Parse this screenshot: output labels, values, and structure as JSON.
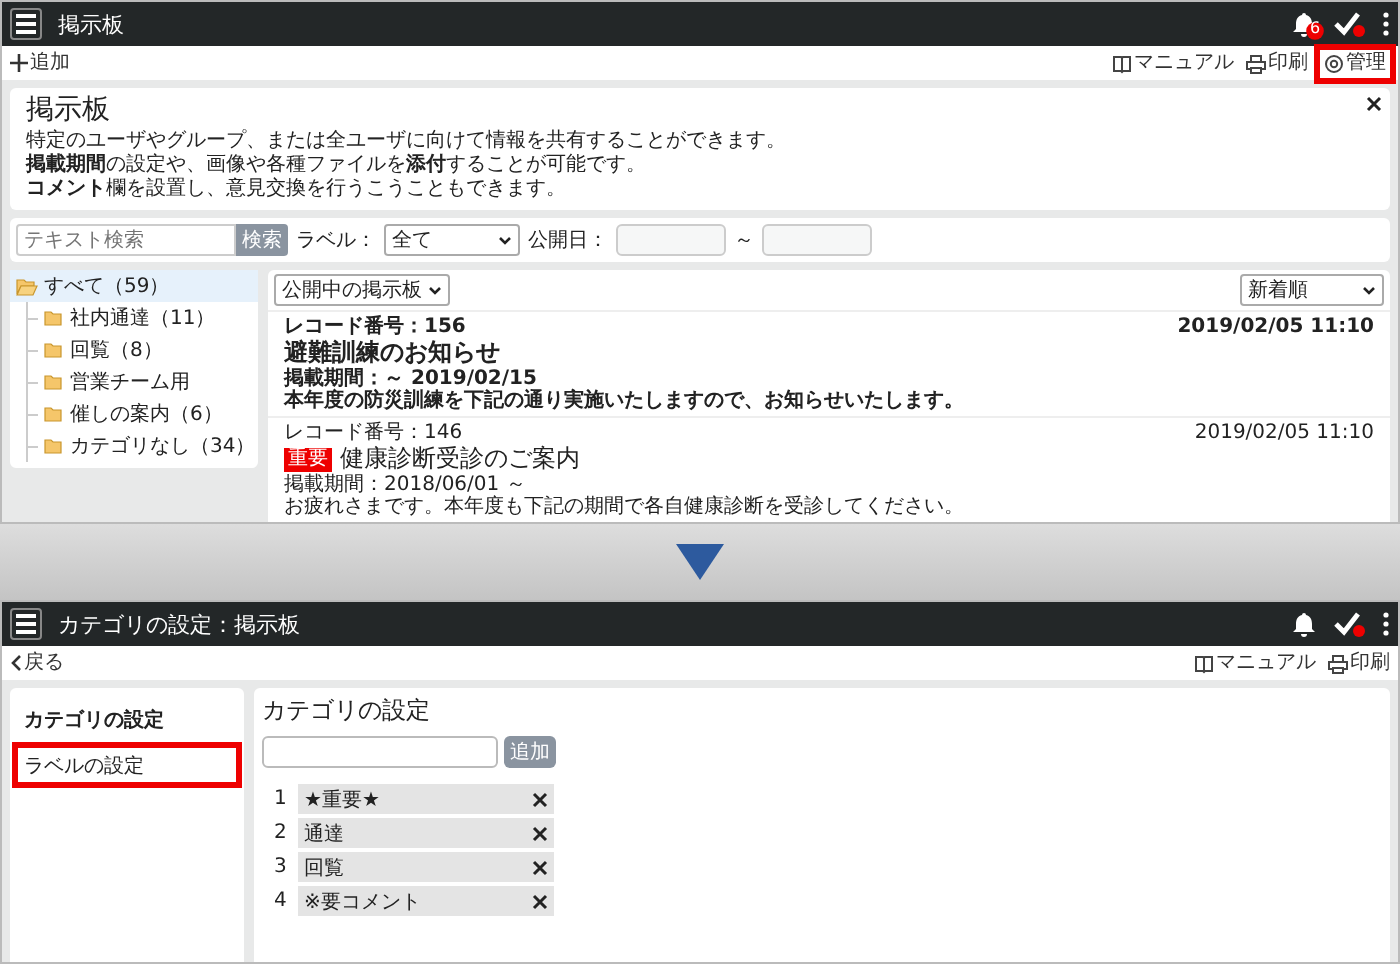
{
  "top_screen": {
    "header": {
      "title": "掲示板",
      "notification_count": "6"
    },
    "toolbar": {
      "add": "追加",
      "links": [
        {
          "kind": "manual",
          "label": "マニュアル",
          "highlighted": false
        },
        {
          "kind": "print",
          "label": "印刷",
          "highlighted": false
        },
        {
          "kind": "admin",
          "label": "管理",
          "highlighted": true
        }
      ]
    },
    "info_panel": {
      "title": "掲示板",
      "lines": [
        "特定のユーザやグループ、または全ユーザに向けて情報を共有することができます。",
        "**掲載期間**の設定や、画像や各種ファイルを**添付**することが可能です。",
        "**コメント**欄を設置し、意見交換を行うこうこともできます。"
      ]
    },
    "filter": {
      "search_placeholder": "テキスト検索",
      "search_button": "検索",
      "label_label": "ラベル：",
      "label_value": "全て",
      "date_label": "公開日：",
      "date_separator": "～"
    },
    "tree": [
      {
        "label": "すべて（59）",
        "selected": true,
        "expanded": true,
        "children": [
          {
            "label": "社内通達（11）",
            "selected": false
          },
          {
            "label": "回覧（8）",
            "selected": false
          },
          {
            "label": "営業チーム用",
            "selected": false
          },
          {
            "label": "催しの案内（6）",
            "selected": false
          },
          {
            "label": "カテゴリなし（34）",
            "selected": false
          }
        ]
      }
    ],
    "list": {
      "status_filter": "公開中の掲示板",
      "sort": "新着順",
      "posts": [
        {
          "record": "レコード番号：156",
          "title": "避難訓練のお知らせ",
          "period": "掲載期間：～ 2019/02/15",
          "body": "本年度の防災訓練を下記の通り実施いたしますので、お知らせいたします。",
          "date": "2019/02/05 11:10",
          "unread": true
        },
        {
          "record": "レコード番号：146",
          "tag": "重要",
          "title": "健康診断受診のご案内",
          "period": "掲載期間：2018/06/01 ～",
          "body": "お疲れさまです。本年度も下記の期間で各自健康診断を受診してください。",
          "date": "2019/02/05 11:10",
          "unread": false
        }
      ]
    }
  },
  "bottom_screen": {
    "header": {
      "title": "カテゴリの設定：掲示板"
    },
    "toolbar": {
      "back": "戻る",
      "links": [
        {
          "kind": "manual",
          "label": "マニュアル",
          "highlighted": false
        },
        {
          "kind": "print",
          "label": "印刷",
          "highlighted": false
        }
      ]
    },
    "menu": [
      {
        "label": "カテゴリの設定",
        "selected": true,
        "highlighted": false
      },
      {
        "label": "ラベルの設定",
        "selected": false,
        "highlighted": true
      }
    ],
    "main": {
      "title": "カテゴリの設定",
      "add_button": "追加",
      "labels": [
        {
          "index": "1",
          "name": "★重要★"
        },
        {
          "index": "2",
          "name": "通達"
        },
        {
          "index": "3",
          "name": "回覧"
        },
        {
          "index": "4",
          "name": "※要コメント"
        }
      ]
    }
  }
}
